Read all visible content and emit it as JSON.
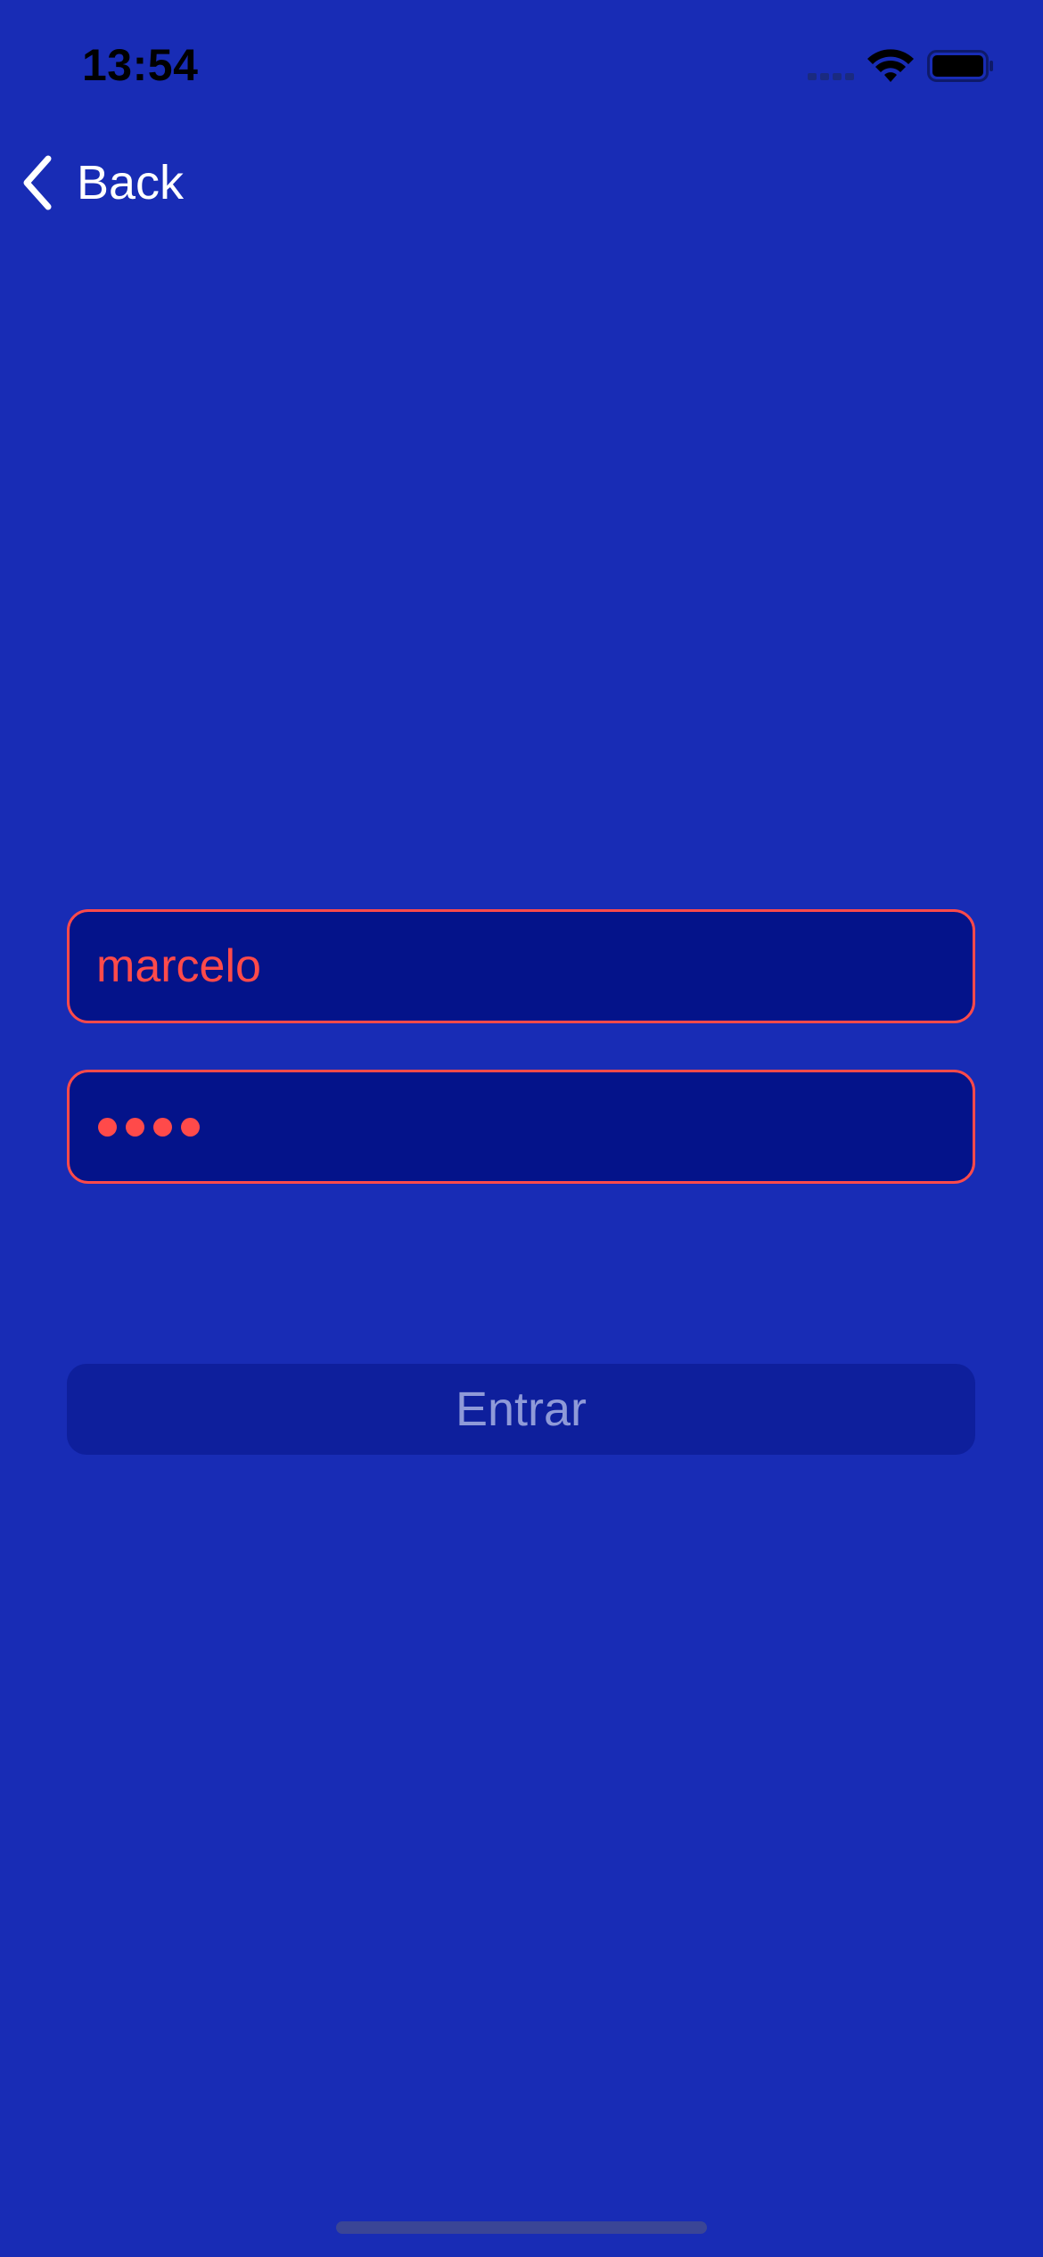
{
  "status_bar": {
    "time": "13:54",
    "signal_icon": "cellular-signal-icon",
    "wifi_icon": "wifi-icon",
    "battery_icon": "battery-icon"
  },
  "nav": {
    "back_icon": "chevron-left-icon",
    "back_label": "Back"
  },
  "form": {
    "username_value": "marcelo",
    "password_value": "••••",
    "password_length": 4,
    "login_label": "Entrar"
  },
  "colors": {
    "background": "#182cb5",
    "field_background": "#04138a",
    "field_accent": "#ff4a4a",
    "button_background": "#0e1f9c",
    "button_text": "#8f9ad8"
  }
}
